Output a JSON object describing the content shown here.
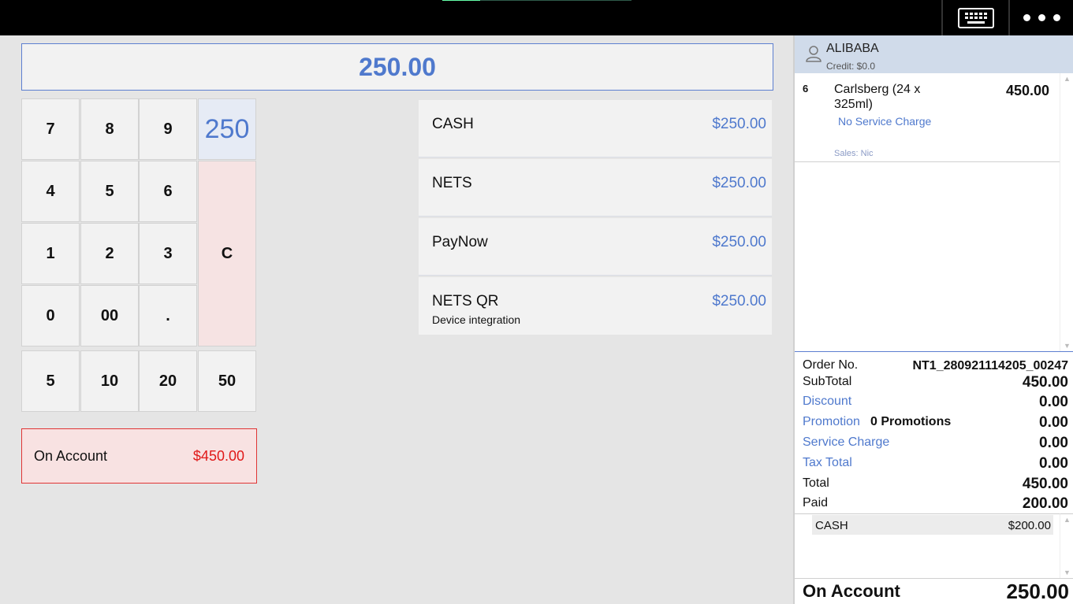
{
  "amount_display": "250.00",
  "keypad": {
    "digits": [
      "7",
      "8",
      "9",
      "4",
      "5",
      "6",
      "1",
      "2",
      "3",
      "0",
      "00",
      "."
    ],
    "quick_amount": "250",
    "clear": "C",
    "preset_amounts": [
      "5",
      "10",
      "20",
      "50"
    ]
  },
  "on_account_box": {
    "label": "On Account",
    "amount": "$450.00"
  },
  "payment_methods": [
    {
      "name": "CASH",
      "amount": "$250.00",
      "sub": ""
    },
    {
      "name": "NETS",
      "amount": "$250.00",
      "sub": ""
    },
    {
      "name": "PayNow",
      "amount": "$250.00",
      "sub": ""
    },
    {
      "name": "NETS QR",
      "amount": "$250.00",
      "sub": "Device integration"
    }
  ],
  "customer": {
    "name": "ALIBABA",
    "credit": "Credit: $0.0"
  },
  "items": [
    {
      "qty": "6",
      "name": "Carlsberg (24 x 325ml)",
      "price": "450.00",
      "service": "No Service Charge",
      "sales": "Sales: Nic"
    }
  ],
  "summary": {
    "order_no_label": "Order No.",
    "order_no": "NT1_280921114205_00247",
    "subtotal_label": "SubTotal",
    "subtotal": "450.00",
    "discount_label": "Discount",
    "discount": "0.00",
    "promotion_label": "Promotion",
    "promotion_count": "0 Promotions",
    "promotion": "0.00",
    "service_charge_label": "Service Charge",
    "service_charge": "0.00",
    "tax_total_label": "Tax Total",
    "tax_total": "0.00",
    "total_label": "Total",
    "total": "450.00",
    "paid_label": "Paid",
    "paid": "200.00"
  },
  "payments_made": [
    {
      "name": "CASH",
      "amount": "$200.00"
    }
  ],
  "bottom": {
    "label": "On Account",
    "amount": "250.00"
  },
  "topbar": {
    "keyboard_icon": "keyboard-icon",
    "more_icon": "more-horizontal-icon",
    "progress": 0.2
  },
  "colors": {
    "accent": "#4f79cd",
    "danger": "#e01818",
    "topbar": "#000000",
    "customer_bar": "#d0dbea"
  }
}
